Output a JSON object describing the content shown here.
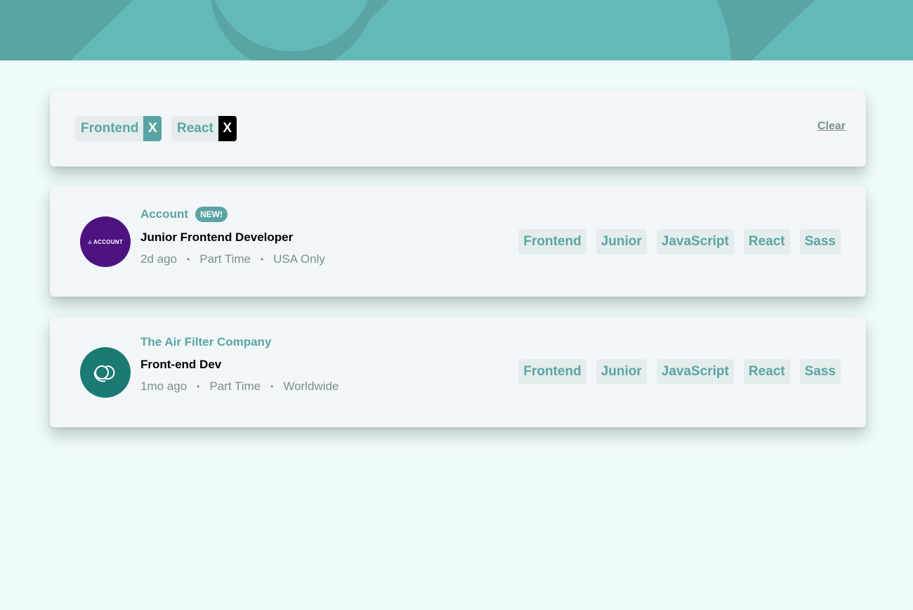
{
  "theme": {
    "header_color": "#5ba4a4",
    "background": "#effafa",
    "accent": "#5ba4a4",
    "remove_dark": "#000000"
  },
  "filters": {
    "chips": [
      {
        "label": "Frontend",
        "remove": "X"
      },
      {
        "label": "React",
        "remove": "X"
      }
    ],
    "clear_label": "Clear"
  },
  "jobs": [
    {
      "logo_text": "ACCOUNT",
      "logo_icon": "account-logo",
      "company": "Account",
      "badge": "NEW!",
      "position": "Junior Frontend Developer",
      "posted": "2d ago",
      "contract": "Part Time",
      "location": "USA Only",
      "separator": "•",
      "tags": [
        "Frontend",
        "Junior",
        "JavaScript",
        "React",
        "Sass"
      ]
    },
    {
      "logo_icon": "air-filter-logo",
      "company": "The Air Filter Company",
      "position": "Front-end Dev",
      "posted": "1mo ago",
      "contract": "Part Time",
      "location": "Worldwide",
      "separator": "•",
      "tags": [
        "Frontend",
        "Junior",
        "JavaScript",
        "React",
        "Sass"
      ]
    }
  ]
}
